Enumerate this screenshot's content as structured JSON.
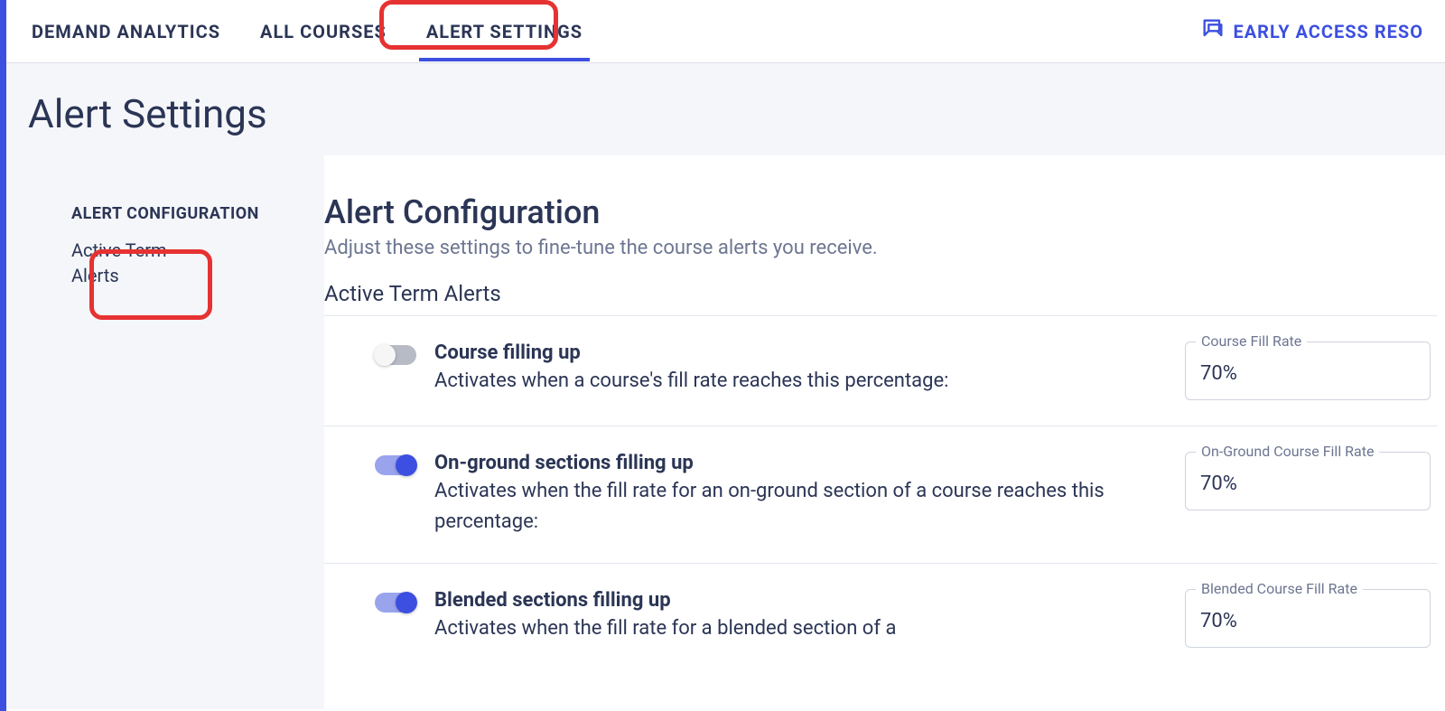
{
  "nav": {
    "tabs": [
      {
        "label": "DEMAND ANALYTICS"
      },
      {
        "label": "ALL COURSES"
      },
      {
        "label": "ALERT SETTINGS"
      }
    ],
    "early_access_label": "EARLY ACCESS RESO"
  },
  "page": {
    "title": "Alert Settings"
  },
  "sidebar": {
    "heading": "ALERT CONFIGURATION",
    "item_active_term_alerts": "Active Term Alerts"
  },
  "main": {
    "title": "Alert Configuration",
    "subtitle": "Adjust these settings to fine-tune the course alerts you receive.",
    "section_title": "Active Term Alerts",
    "alerts": [
      {
        "enabled": false,
        "title": "Course filling up",
        "description": "Activates when a course's fill rate reaches this percentage:",
        "field_label": "Course Fill Rate",
        "field_value": "70%"
      },
      {
        "enabled": true,
        "title": "On-ground sections filling up",
        "description": "Activates when the fill rate for an on-ground section of a course reaches this percentage:",
        "field_label": "On-Ground Course Fill Rate",
        "field_value": "70%"
      },
      {
        "enabled": true,
        "title": "Blended sections filling up",
        "description": "Activates when the fill rate for a blended section of a",
        "field_label": "Blended Course Fill Rate",
        "field_value": "70%"
      }
    ]
  }
}
